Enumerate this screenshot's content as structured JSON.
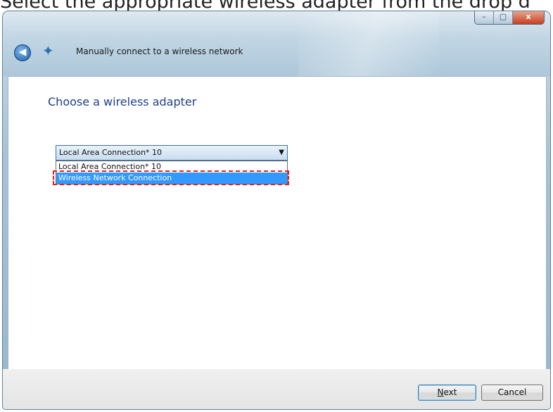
{
  "caption": "Select the appropriate wireless adapter from the drop d",
  "window": {
    "title": "Manually connect to a wireless network",
    "caption_buttons": {
      "minimize": "–",
      "maximize": "▢",
      "close": "x"
    }
  },
  "main": {
    "heading": "Choose a wireless adapter",
    "adapter_select": {
      "selected": "Local Area Connection* 10",
      "options": [
        "Local Area Connection* 10",
        "Wireless Network Connection"
      ],
      "highlighted_index": 1
    }
  },
  "footer": {
    "next_label_accel": "N",
    "next_label_rest": "ext",
    "cancel_label": "Cancel"
  },
  "colors": {
    "selection": "#3399ff",
    "heading": "#1e3f8a",
    "annotation": "#e02020"
  },
  "icons": {
    "back": "back-arrow-icon",
    "network": "network-icon",
    "dropdown": "chevron-down-icon"
  }
}
